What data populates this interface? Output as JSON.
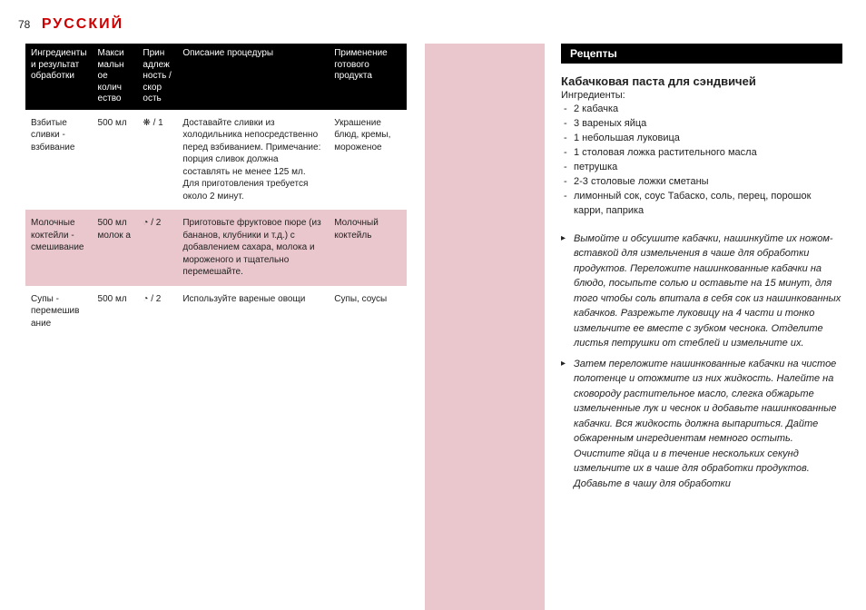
{
  "header": {
    "page_number": "78",
    "language": "РУССКИЙ"
  },
  "table": {
    "headers": {
      "c1": "Ингредиенты и результат обработки",
      "c2": "Макси мальн ое колич ество",
      "c3": "Прин адлеж ность /скор ость",
      "c4": "Описание процедуры",
      "c5": "Применение готового продукта"
    },
    "rows": [
      {
        "c1": "Взбитые сливки - взбивание",
        "c2": "500 мл",
        "c3_icon": "sun-icon",
        "c3_text": " / 1",
        "c4": "Доставайте сливки из холодильника непосредственно перед взбиванием. Примечание: порция сливок должна составлять не менее 125 мл. Для приготовления требуется около 2 минут.",
        "c5": "Украшение блюд, кремы, мороженое"
      },
      {
        "c1": "Молочные коктейли - смешивание",
        "c2": "500 мл молок а",
        "c3_icon": "clock-icon",
        "c3_text": " / 2",
        "c4": "Приготовьте фруктовое пюре (из бананов, клубники и т.д.) с добавлением сахара, молока и мороженого и тщательно перемешайте.",
        "c5": "Молочный коктейль"
      },
      {
        "c1": "Супы - перемешив ание",
        "c2": "500 мл",
        "c3_icon": "clock-icon",
        "c3_text": " / 2",
        "c4": "Используйте вареные овощи",
        "c5": "Супы, соусы"
      }
    ]
  },
  "recipe": {
    "section_title": "Рецепты",
    "title": "Кабачковая паста для сэндвичей",
    "ingredients_label": "Ингредиенты:",
    "ingredients": [
      "2 кабачка",
      "3 вареных яйца",
      "1 небольшая луковица",
      "1 столовая ложка растительного масла",
      "петрушка",
      "2-3 столовые ложки сметаны",
      "лимонный сок, соус Табаско, соль, перец, порошок карри, паприка"
    ],
    "steps": [
      "Вымойте и обсушите кабачки, нашинкуйте их ножом-вставкой для измельчения в чаше для обработки продуктов. Переложите нашинкованные кабачки на блюдо, посыпьте солью и оставьте на 15 минут, для того чтобы соль впитала в себя сок из нашинкованных кабачков. Разрежьте луковицу на 4 части и тонко измельчите ее вместе с зубком чеснока. Отделите листья петрушки от стеблей и измельчите их.",
      "Затем переложите нашинкованные кабачки на чистое полотенце и отожмите из них жидкость. Налейте на сковороду растительное масло, слегка обжарьте измельченные лук и чеснок и добавьте нашинкованные кабачки. Вся жидкость должна выпариться. Дайте обжаренным ингредиентам немного остыть. Очистите яйца и в течение нескольких секунд измельчите их в чаше для обработки продуктов. Добавьте в чашу для обработки"
    ]
  },
  "icons": {
    "sun-icon": "❋",
    "clock-icon": "◔"
  }
}
